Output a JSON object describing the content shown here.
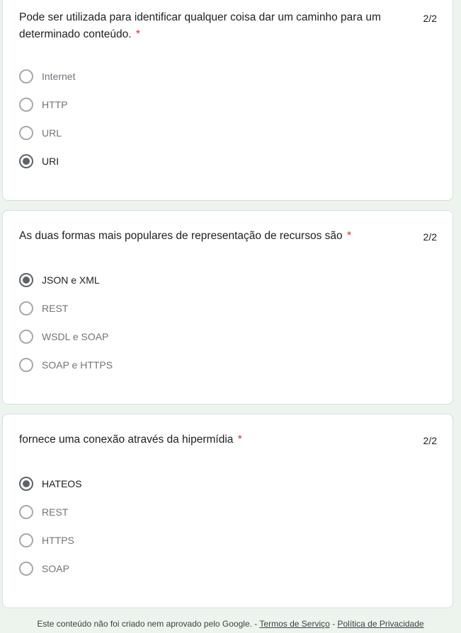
{
  "questions": [
    {
      "title": "Pode ser utilizada para identificar qualquer coisa dar um caminho para um determinado conteúdo.",
      "required_mark": "*",
      "score": "2/2",
      "options": [
        {
          "label": "Internet",
          "selected": false
        },
        {
          "label": "HTTP",
          "selected": false
        },
        {
          "label": "URL",
          "selected": false
        },
        {
          "label": "URI",
          "selected": true
        }
      ]
    },
    {
      "title": "As duas formas mais populares de representação de recursos são",
      "required_mark": "*",
      "score": "2/2",
      "options": [
        {
          "label": "JSON e XML",
          "selected": true
        },
        {
          "label": "REST",
          "selected": false
        },
        {
          "label": "WSDL e SOAP",
          "selected": false
        },
        {
          "label": "SOAP e HTTPS",
          "selected": false
        }
      ]
    },
    {
      "title": "fornece uma conexão através da hipermídia",
      "required_mark": "*",
      "score": "2/2",
      "options": [
        {
          "label": "HATEOS",
          "selected": true
        },
        {
          "label": "REST",
          "selected": false
        },
        {
          "label": "HTTPS",
          "selected": false
        },
        {
          "label": "SOAP",
          "selected": false
        }
      ]
    }
  ],
  "footer": {
    "text": "Este conteúdo não foi criado nem aprovado pelo Google. -",
    "separator": "-",
    "terms_link": "Termos de Serviço",
    "privacy_link": "Política de Privacidade"
  },
  "colors": {
    "page_background": "#edf4ee",
    "required_star": "#d93025",
    "radio": "#5f6368"
  }
}
